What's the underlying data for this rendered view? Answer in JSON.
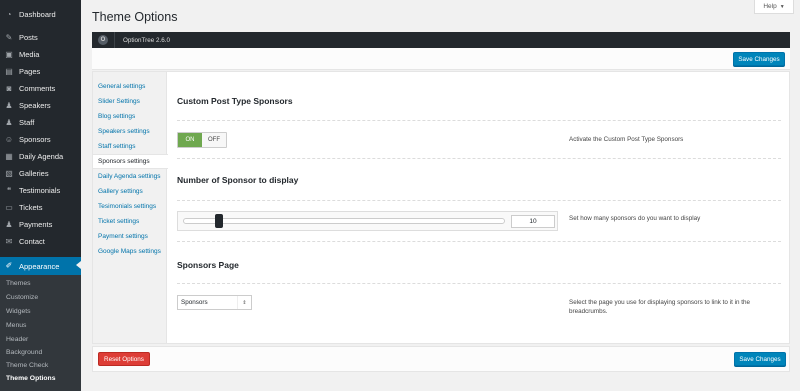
{
  "sidebar": {
    "items": [
      {
        "label": "Dashboard",
        "icon": "dashboard-icon",
        "glyph": "◔"
      },
      {
        "label": "Posts",
        "icon": "pin-icon",
        "glyph": "✎"
      },
      {
        "label": "Media",
        "icon": "media-icon",
        "glyph": "▣"
      },
      {
        "label": "Pages",
        "icon": "page-icon",
        "glyph": "▤"
      },
      {
        "label": "Comments",
        "icon": "comment-icon",
        "glyph": "◙"
      },
      {
        "label": "Speakers",
        "icon": "speakers-icon",
        "glyph": "♟"
      },
      {
        "label": "Staff",
        "icon": "staff-icon",
        "glyph": "♟"
      },
      {
        "label": "Sponsors",
        "icon": "sponsors-icon",
        "glyph": "☺"
      },
      {
        "label": "Daily Agenda",
        "icon": "calendar-icon",
        "glyph": "▦"
      },
      {
        "label": "Galleries",
        "icon": "gallery-icon",
        "glyph": "▧"
      },
      {
        "label": "Testimonials",
        "icon": "testimonial-icon",
        "glyph": "❝"
      },
      {
        "label": "Tickets",
        "icon": "ticket-icon",
        "glyph": "▭"
      },
      {
        "label": "Payments",
        "icon": "payments-icon",
        "glyph": "♟"
      },
      {
        "label": "Contact",
        "icon": "mail-icon",
        "glyph": "✉"
      },
      {
        "label": "Appearance",
        "icon": "paintbrush-icon",
        "glyph": "✐"
      }
    ],
    "submenu": [
      "Themes",
      "Customize",
      "Widgets",
      "Menus",
      "Header",
      "Background",
      "Theme Check",
      "Theme Options"
    ]
  },
  "header": {
    "title": "Theme Options",
    "help_label": "Help",
    "help_caret": "▼"
  },
  "optiontree": {
    "logo_glyph": "O",
    "version": "OptionTree 2.6.0"
  },
  "actions": {
    "save_label": "Save Changes",
    "reset_label": "Reset Options"
  },
  "tabs": [
    "General settings",
    "Slider Settings",
    "Blog settings",
    "Speakers settings",
    "Staff settings",
    "Sponsors settings",
    "Daily Agenda settings",
    "Gallery settings",
    "Tesimonials settings",
    "Ticket settings",
    "Payment settings",
    "Google Maps settings"
  ],
  "active_tab_index": 5,
  "sections": {
    "cpt": {
      "title": "Custom Post Type Sponsors",
      "on_label": "ON",
      "off_label": "OFF",
      "value": "on",
      "description": "Activate the Custom Post Type Sponsors"
    },
    "count": {
      "title": "Number of Sponsor to display",
      "value": "10",
      "slider_fraction": 0.1,
      "description": "Set how many sponsors do you want to display"
    },
    "page": {
      "title": "Sponsors Page",
      "selected": "Sponsors",
      "arrow": "⇕",
      "description": "Select the page you use for displaying sponsors to link to it in the breadcrumbs."
    }
  },
  "colors": {
    "sidebar_bg": "#23282d",
    "accent": "#0073aa",
    "primary_button": "#0085ba",
    "danger_button": "#dd3d36",
    "toggle_on": "#6fa84f"
  }
}
